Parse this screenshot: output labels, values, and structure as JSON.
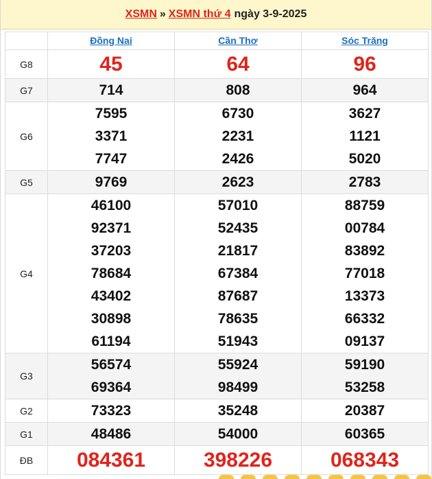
{
  "header": {
    "link1": "XSMN",
    "sep": "»",
    "link2": "XSMN thứ 4",
    "date": "ngày 3-9-2025"
  },
  "provinces": [
    "Đồng Nai",
    "Cần Thơ",
    "Sóc Trăng"
  ],
  "prizes": [
    {
      "label": "G8",
      "values": [
        [
          "45"
        ],
        [
          "64"
        ],
        [
          "96"
        ]
      ],
      "big": true,
      "alt": false
    },
    {
      "label": "G7",
      "values": [
        [
          "714"
        ],
        [
          "808"
        ],
        [
          "964"
        ]
      ],
      "big": false,
      "alt": true
    },
    {
      "label": "G6",
      "values": [
        [
          "7595",
          "3371",
          "7747"
        ],
        [
          "6730",
          "2231",
          "2426"
        ],
        [
          "3627",
          "1121",
          "5020"
        ]
      ],
      "big": false,
      "alt": false
    },
    {
      "label": "G5",
      "values": [
        [
          "9769"
        ],
        [
          "2623"
        ],
        [
          "2783"
        ]
      ],
      "big": false,
      "alt": true
    },
    {
      "label": "G4",
      "values": [
        [
          "46100",
          "92371",
          "37203",
          "78684",
          "43402",
          "30898",
          "61194"
        ],
        [
          "57010",
          "52435",
          "21817",
          "67384",
          "87687",
          "78635",
          "51943"
        ],
        [
          "88759",
          "00784",
          "83892",
          "77018",
          "13373",
          "66332",
          "09137"
        ]
      ],
      "big": false,
      "alt": false
    },
    {
      "label": "G3",
      "values": [
        [
          "56574",
          "69364"
        ],
        [
          "55924",
          "98499"
        ],
        [
          "59190",
          "53258"
        ]
      ],
      "big": false,
      "alt": true
    },
    {
      "label": "G2",
      "values": [
        [
          "73323"
        ],
        [
          "35248"
        ],
        [
          "20387"
        ]
      ],
      "big": false,
      "alt": false
    },
    {
      "label": "G1",
      "values": [
        [
          "48486"
        ],
        [
          "54000"
        ],
        [
          "60365"
        ]
      ],
      "big": false,
      "alt": true
    },
    {
      "label": "ĐB",
      "values": [
        [
          "084361"
        ],
        [
          "398226"
        ],
        [
          "068343"
        ]
      ],
      "big": true,
      "alt": false
    }
  ],
  "colors": {
    "accent_red": "#e0241b",
    "link_blue": "#1a6fc2",
    "header_bg": "#fff7cc"
  }
}
